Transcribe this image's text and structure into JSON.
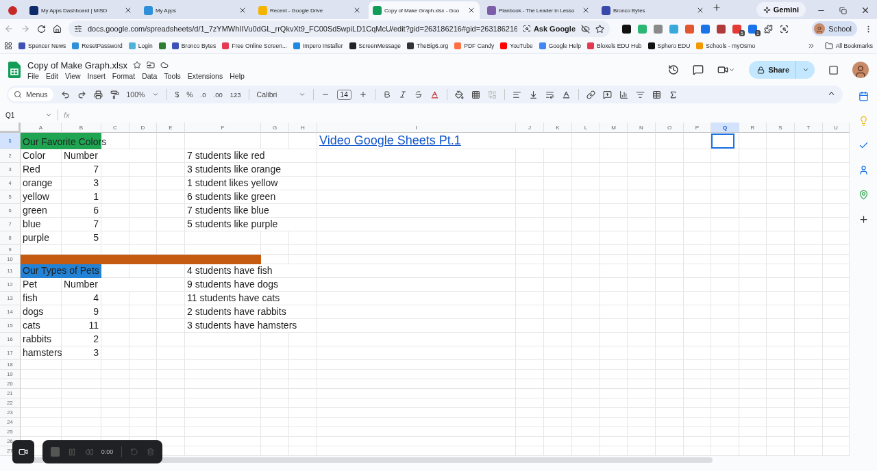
{
  "browser": {
    "tabs": [
      {
        "color": "#c62828",
        "selected": false
      },
      {
        "title": "My Apps Dashboard | MISD",
        "color": "#0d2a6b",
        "selected": false
      },
      {
        "title": "My Apps",
        "color": "#2f8fd8",
        "selected": false
      },
      {
        "title": "Recent - Google Drive",
        "color": "#f4b400",
        "selected": false
      },
      {
        "title": "Copy of Make Graph.xlsx - Goo",
        "color": "#0f9d58",
        "selected": true
      },
      {
        "title": "Planbook - The Leader in Lesso",
        "color": "#7b5ea7",
        "selected": false
      },
      {
        "title": "Bronco Bytes",
        "color": "#3949ab",
        "selected": false
      }
    ],
    "gemini": "Gemini",
    "url": "docs.google.com/spreadsheets/d/1_7zYMWhIIVu0dGL_rrQkvXt9_FC00Sd5wpiLD1CqMcU/edit?gid=263186216#gid=263186216",
    "ask_google": "Ask Google",
    "extensions": [
      {
        "color": "#111111"
      },
      {
        "color": "#2bb673"
      },
      {
        "color": "#8a8a8a"
      },
      {
        "color": "#39a9db"
      },
      {
        "color": "#e4572e"
      },
      {
        "color": "#1a73e8"
      },
      {
        "color": "#b03a3a"
      },
      {
        "color": "#e53935",
        "badge": "5"
      },
      {
        "color": "#1a73e8",
        "badge": "1"
      }
    ],
    "profile": "School",
    "bookmarks": [
      {
        "label": "Spencer News",
        "color": "#3f51b5"
      },
      {
        "label": "ResetPassword",
        "color": "#2f8fd8"
      },
      {
        "label": "Login",
        "color": "#4fb3d9"
      },
      {
        "color": "#2e7d32"
      },
      {
        "label": "Bronco Bytes",
        "color": "#3f51b5"
      },
      {
        "label": "Free Online Screen...",
        "color": "#e53950"
      },
      {
        "label": "Impero Installer",
        "color": "#1e88e5"
      },
      {
        "label": "ScreenMessage",
        "color": "#222222"
      },
      {
        "label": "TheBig6.org",
        "color": "#333333"
      },
      {
        "label": "PDF Candy",
        "color": "#ff7043"
      },
      {
        "label": "YouTube",
        "color": "#ff0000"
      },
      {
        "label": "Google Help",
        "color": "#4285f4"
      },
      {
        "label": "Bloxels EDU Hub",
        "color": "#e53950"
      },
      {
        "label": "Sphero EDU",
        "color": "#111111"
      },
      {
        "label": "Schools - myOsmo",
        "color": "#f29900"
      }
    ],
    "all_bookmarks": "All Bookmarks"
  },
  "doc": {
    "title": "Copy of Make Graph.xlsx",
    "menus": [
      "File",
      "Edit",
      "View",
      "Insert",
      "Format",
      "Data",
      "Tools",
      "Extensions",
      "Help"
    ],
    "share": "Share",
    "toolbar": {
      "menus_search": "Menus",
      "zoom": "100%",
      "currency": "$",
      "percent": "%",
      "decrease_decimal": ".0",
      "increase_decimal": ".00",
      "number_format": "123",
      "font": "Calibri",
      "font_size": "14"
    },
    "name_box": "Q1",
    "formula_label": "fx"
  },
  "grid": {
    "columns": [
      {
        "label": "A",
        "selected": false
      },
      {
        "label": "B",
        "selected": false
      },
      {
        "label": "C",
        "selected": false
      },
      {
        "label": "D",
        "selected": false
      },
      {
        "label": "E",
        "selected": false
      },
      {
        "label": "F",
        "selected": false
      },
      {
        "label": "G",
        "selected": false
      },
      {
        "label": "H",
        "selected": false
      },
      {
        "label": "I",
        "selected": false
      },
      {
        "label": "J",
        "selected": false
      },
      {
        "label": "K",
        "selected": false
      },
      {
        "label": "L",
        "selected": false
      },
      {
        "label": "M",
        "selected": false
      },
      {
        "label": "N",
        "selected": false
      },
      {
        "label": "O",
        "selected": false
      },
      {
        "label": "P",
        "selected": false
      },
      {
        "label": "Q",
        "selected": true
      },
      {
        "label": "R",
        "selected": false
      },
      {
        "label": "S",
        "selected": false
      },
      {
        "label": "T",
        "selected": false
      },
      {
        "label": "U",
        "selected": false
      }
    ],
    "rows": [
      {
        "label": "1",
        "selected": true,
        "cells": [
          {
            "text": "Our Favorite Colors",
            "color": "#1fa552"
          },
          {
            "color": "#1fa552"
          },
          null,
          null,
          null,
          null,
          null,
          null,
          {
            "text": "Video Google Sheets Pt.1",
            "kind": "link"
          }
        ]
      },
      {
        "label": "2",
        "selected": false,
        "cells": [
          {
            "text": "Color"
          },
          {
            "text": "Number"
          },
          null,
          null,
          null,
          {
            "text": "7 students like red"
          }
        ]
      },
      {
        "label": "3",
        "selected": false,
        "cells": [
          {
            "text": "Red"
          },
          {
            "text": "7",
            "kind": "number"
          },
          null,
          null,
          null,
          {
            "text": "3 students like orange"
          }
        ]
      },
      {
        "label": "4",
        "selected": false,
        "cells": [
          {
            "text": "orange"
          },
          {
            "text": "3",
            "kind": "number"
          },
          null,
          null,
          null,
          {
            "text": "1 student likes yellow"
          }
        ]
      },
      {
        "label": "5",
        "selected": false,
        "cells": [
          {
            "text": "yellow"
          },
          {
            "text": "1",
            "kind": "number"
          },
          null,
          null,
          null,
          {
            "text": "6 students like green"
          }
        ]
      },
      {
        "label": "6",
        "selected": false,
        "cells": [
          {
            "text": "green"
          },
          {
            "text": "6",
            "kind": "number"
          },
          null,
          null,
          null,
          {
            "text": "7 students like blue"
          }
        ]
      },
      {
        "label": "7",
        "selected": false,
        "cells": [
          {
            "text": "blue"
          },
          {
            "text": "7",
            "kind": "number"
          },
          null,
          null,
          null,
          {
            "text": "5 students like purple"
          }
        ]
      },
      {
        "label": "8",
        "selected": false,
        "cells": [
          {
            "text": "purple"
          },
          {
            "text": "5",
            "kind": "number"
          }
        ]
      },
      {
        "label": "9",
        "selected": false,
        "cells": []
      },
      {
        "label": "10",
        "selected": false,
        "cells": [
          {
            "color": "#c55a11"
          },
          {
            "color": "#c55a11"
          },
          {
            "color": "#c55a11"
          },
          {
            "color": "#c55a11"
          },
          {
            "color": "#c55a11"
          },
          {
            "color": "#c55a11"
          }
        ]
      },
      {
        "label": "11",
        "selected": false,
        "cells": [
          {
            "text": "Our Types of Pets",
            "color": "#2283d6"
          },
          {
            "color": "#2283d6"
          },
          null,
          null,
          null,
          {
            "text": "4 students have fish"
          }
        ]
      },
      {
        "label": "12",
        "selected": false,
        "cells": [
          {
            "text": "Pet"
          },
          {
            "text": "Number"
          },
          null,
          null,
          null,
          {
            "text": "9 students have dogs"
          }
        ]
      },
      {
        "label": "13",
        "selected": false,
        "cells": [
          {
            "text": "fish"
          },
          {
            "text": "4",
            "kind": "number"
          },
          null,
          null,
          null,
          {
            "text": "11 students have cats"
          }
        ]
      },
      {
        "label": "14",
        "selected": false,
        "cells": [
          {
            "text": "dogs"
          },
          {
            "text": "9",
            "kind": "number"
          },
          null,
          null,
          null,
          {
            "text": "2 students have rabbits"
          }
        ]
      },
      {
        "label": "15",
        "selected": false,
        "cells": [
          {
            "text": "cats"
          },
          {
            "text": "11",
            "kind": "number"
          },
          null,
          null,
          null,
          {
            "text": "3 students have hamsters"
          }
        ]
      },
      {
        "label": "16",
        "selected": false,
        "cells": [
          {
            "text": "rabbits"
          },
          {
            "text": "2",
            "kind": "number"
          }
        ]
      },
      {
        "label": "17",
        "selected": false,
        "cells": [
          {
            "text": "hamsters"
          },
          {
            "text": "3",
            "kind": "number"
          }
        ]
      },
      {
        "label": "18",
        "selected": false,
        "cells": []
      },
      {
        "label": "19",
        "selected": false,
        "cells": []
      },
      {
        "label": "20",
        "selected": false,
        "cells": []
      },
      {
        "label": "21",
        "selected": false,
        "cells": []
      },
      {
        "label": "22",
        "selected": false,
        "cells": []
      },
      {
        "label": "23",
        "selected": false,
        "cells": []
      },
      {
        "label": "24",
        "selected": false,
        "cells": []
      },
      {
        "label": "25",
        "selected": false,
        "cells": []
      },
      {
        "label": "26",
        "selected": false,
        "cells": []
      },
      {
        "label": "27",
        "selected": false,
        "cells": []
      }
    ]
  },
  "recorder": {
    "timer": "0:00"
  }
}
